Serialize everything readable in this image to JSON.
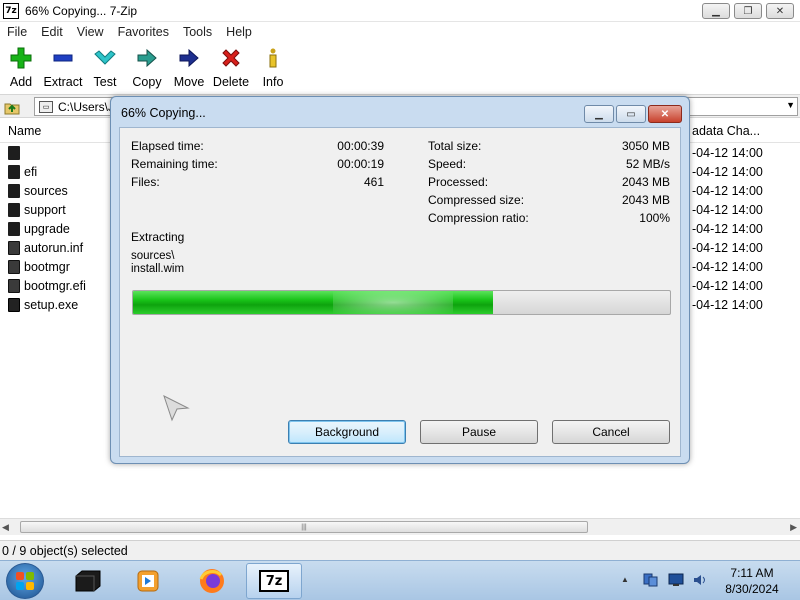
{
  "window": {
    "icon_text": "7z",
    "title": "66% Copying... 7-Zip"
  },
  "menu": [
    "File",
    "Edit",
    "View",
    "Favorites",
    "Tools",
    "Help"
  ],
  "toolbar": {
    "add": "Add",
    "extract": "Extract",
    "test": "Test",
    "copy": "Copy",
    "move": "Move",
    "delete": "Delete",
    "info": "Info"
  },
  "address": {
    "path": "C:\\Users\\J"
  },
  "list": {
    "col_name": "Name",
    "col_meta": "adata Cha...",
    "rows": [
      {
        "name": "",
        "date": "-04-12 14:00"
      },
      {
        "name": "efi",
        "date": "-04-12 14:00"
      },
      {
        "name": "sources",
        "date": "-04-12 14:00"
      },
      {
        "name": "support",
        "date": "-04-12 14:00"
      },
      {
        "name": "upgrade",
        "date": "-04-12 14:00"
      },
      {
        "name": "autorun.inf",
        "date": "-04-12 14:00"
      },
      {
        "name": "bootmgr",
        "date": "-04-12 14:00"
      },
      {
        "name": "bootmgr.efi",
        "date": "-04-12 14:00"
      },
      {
        "name": "setup.exe",
        "date": "-04-12 14:00"
      }
    ]
  },
  "status": {
    "selection": "0 / 9 object(s) selected"
  },
  "dialog": {
    "title": "66% Copying...",
    "elapsed_label": "Elapsed time:",
    "elapsed_value": "00:00:39",
    "remaining_label": "Remaining time:",
    "remaining_value": "00:00:19",
    "files_label": "Files:",
    "files_value": "461",
    "total_label": "Total size:",
    "total_value": "3050 MB",
    "speed_label": "Speed:",
    "speed_value": "52 MB/s",
    "processed_label": "Processed:",
    "processed_value": "2043 MB",
    "compressed_label": "Compressed size:",
    "compressed_value": "2043 MB",
    "ratio_label": "Compression ratio:",
    "ratio_value": "100%",
    "operation": "Extracting",
    "current_dir": "sources\\",
    "current_file": "install.wim",
    "progress": 0.67,
    "btn_background": "Background",
    "btn_pause": "Pause",
    "btn_cancel": "Cancel"
  },
  "taskbar": {
    "active_app_label": "7z",
    "time": "7:11 AM",
    "date": "8/30/2024"
  },
  "colors": {
    "progress_green": "#18c218",
    "dialog_frame": "#c9dcf0",
    "taskbar": "#b7d0ea"
  }
}
